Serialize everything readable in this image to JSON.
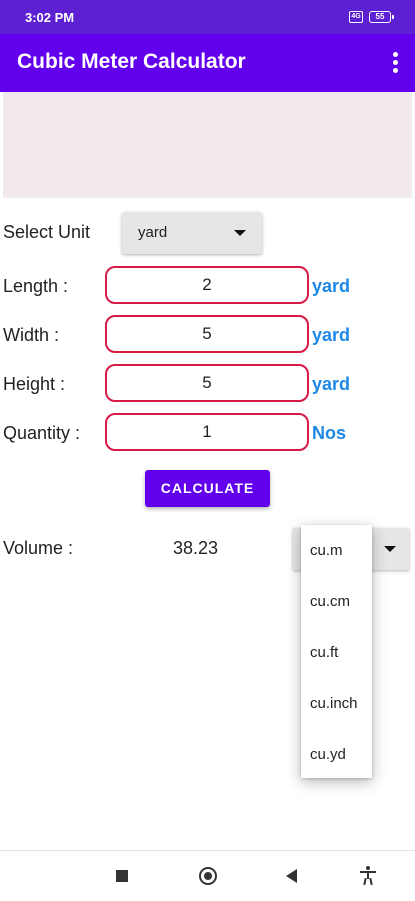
{
  "status_bar": {
    "time": "3:02 PM",
    "data_badge": "4G",
    "battery": "55"
  },
  "app_bar": {
    "title": "Cubic Meter Calculator",
    "menu_icon": "more-vert-icon"
  },
  "form": {
    "select_unit_label": "Select Unit",
    "select_unit_value": "yard",
    "length": {
      "label": "Length :",
      "value": "2",
      "unit": "yard"
    },
    "width": {
      "label": "Width :",
      "value": "5",
      "unit": "yard"
    },
    "height": {
      "label": "Height :",
      "value": "5",
      "unit": "yard"
    },
    "quantity": {
      "label": "Quantity :",
      "value": "1",
      "unit": "Nos"
    },
    "calculate_label": "CALCULATE"
  },
  "result": {
    "volume_label": "Volume :",
    "volume_value": "38.23",
    "options": [
      "cu.m",
      "cu.cm",
      "cu.ft",
      "cu.inch",
      "cu.yd"
    ]
  },
  "colors": {
    "primary": "#6200ee",
    "status_bar": "#5c1fd1",
    "field_border": "#d81b46",
    "unit_text": "#1e88e5",
    "ad_background": "#f2e9ec"
  }
}
